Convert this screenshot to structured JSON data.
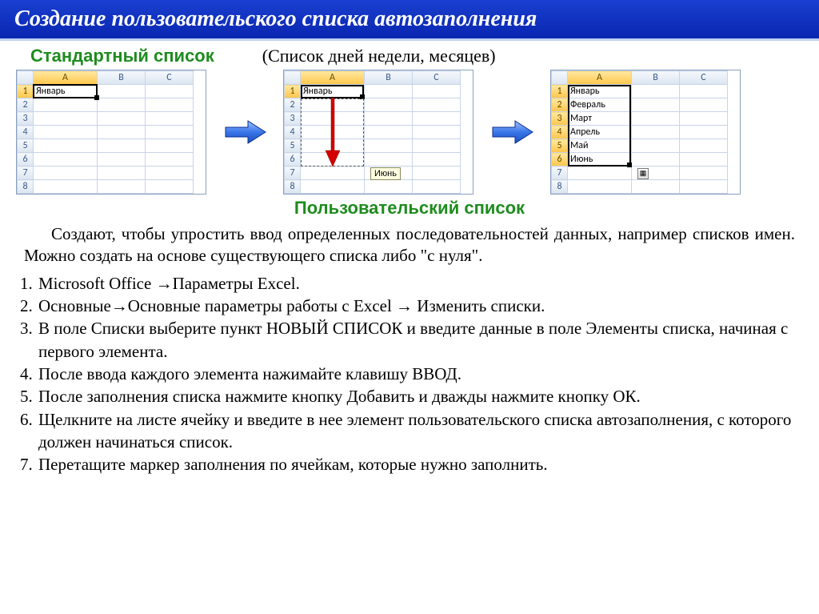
{
  "title": "Создание пользовательского списка автозаполнения",
  "heading_standard": "Стандартный список",
  "heading_paren": "(Список дней недели, месяцев)",
  "heading_custom": "Пользовательский  список",
  "cols": [
    "A",
    "B",
    "C"
  ],
  "rows8": [
    "1",
    "2",
    "3",
    "4",
    "5",
    "6",
    "7",
    "8"
  ],
  "panel1_cell": "Январь",
  "panel2_cell": "Январь",
  "panel2_tooltip": "Июнь",
  "panel3_values": [
    "Январь",
    "Февраль",
    "Март",
    "Апрель",
    "Май",
    "Июнь"
  ],
  "para": "Создают, чтобы упростить ввод определенных последовательностей данных, например списков имен.  Можно создать на основе существующего списка либо \"с нуля\".",
  "steps": [
    "Microsoft Office →Параметры Excel.",
    "Основные→Основные параметры работы с Excel → Изменить списки.",
    "В поле Списки выберите пункт НОВЫЙ СПИСОК и введите данные в поле Элементы списка, начиная с первого элемента.",
    "После ввода каждого элемента нажимайте клавишу ВВОД.",
    "После заполнения списка нажмите кнопку Добавить и дважды нажмите кнопку ОК.",
    "Щелкните на листе ячейку и введите в нее элемент пользовательского списка автозаполнения, с которого должен начинаться список.",
    "Перетащите маркер заполнения по ячейкам, которые нужно заполнить."
  ]
}
